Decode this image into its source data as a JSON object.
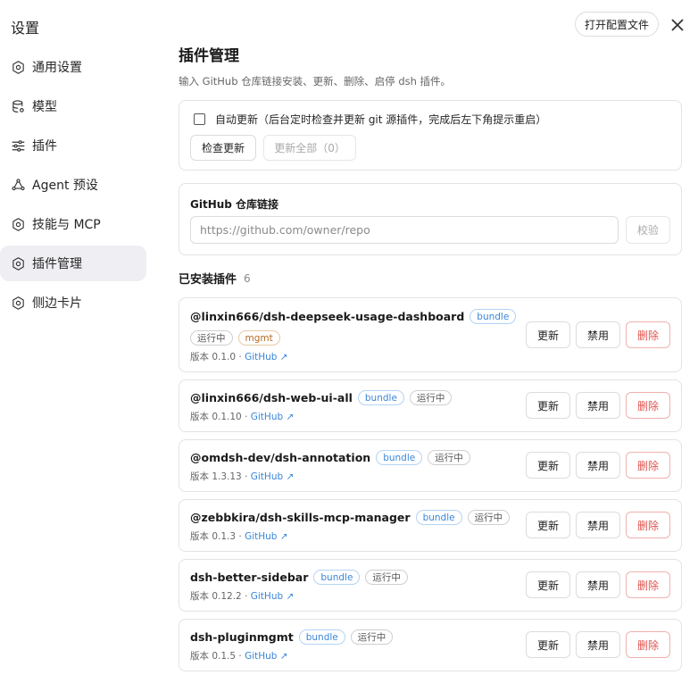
{
  "sidebar": {
    "title": "设置",
    "items": [
      {
        "label": "通用设置",
        "icon": "settings-gear-icon"
      },
      {
        "label": "模型",
        "icon": "database-icon"
      },
      {
        "label": "插件",
        "icon": "sliders-icon"
      },
      {
        "label": "Agent 预设",
        "icon": "agent-icon"
      },
      {
        "label": "技能与 MCP",
        "icon": "settings-gear-icon"
      },
      {
        "label": "插件管理",
        "icon": "settings-gear-icon",
        "active": true
      },
      {
        "label": "侧边卡片",
        "icon": "settings-gear-icon"
      }
    ]
  },
  "header": {
    "open_config_label": "打开配置文件",
    "close_icon": "close-icon"
  },
  "main": {
    "title": "插件管理",
    "description": "输入 GitHub 仓库链接安装、更新、删除、启停 dsh 插件。",
    "auto_update": {
      "checked": false,
      "label": "自动更新（后台定时检查并更新 git 源插件，完成后左下角提示重启）",
      "check_label": "检查更新",
      "update_all_label": "更新全部（0）"
    },
    "repo": {
      "label": "GitHub 仓库链接",
      "placeholder": "https://github.com/owner/repo",
      "verify_label": "校验"
    },
    "installed": {
      "title": "已安装插件",
      "count": "6"
    },
    "plugins": [
      {
        "name": "@linxin666/dsh-deepseek-usage-dashboard",
        "tags": [
          "bundle"
        ],
        "tags2": [
          "运行中",
          "mgmt"
        ],
        "version": "版本 0.1.0 · ",
        "github": "GitHub ↗"
      },
      {
        "name": "@linxin666/dsh-web-ui-all",
        "tags": [
          "bundle",
          "运行中"
        ],
        "version": "版本 0.1.10 · ",
        "github": "GitHub ↗"
      },
      {
        "name": "@omdsh-dev/dsh-annotation",
        "tags": [
          "bundle",
          "运行中"
        ],
        "version": "版本 1.3.13 · ",
        "github": "GitHub ↗"
      },
      {
        "name": "@zebbkira/dsh-skills-mcp-manager",
        "tags": [
          "bundle",
          "运行中"
        ],
        "version": "版本 0.1.3 · ",
        "github": "GitHub ↗"
      },
      {
        "name": "dsh-better-sidebar",
        "tags": [
          "bundle",
          "运行中"
        ],
        "version": "版本 0.12.2 · ",
        "github": "GitHub ↗"
      },
      {
        "name": "dsh-pluginmgmt",
        "tags": [
          "bundle",
          "运行中"
        ],
        "version": "版本 0.1.5 · ",
        "github": "GitHub ↗"
      }
    ],
    "actions": {
      "update_label": "更新",
      "disable_label": "禁用",
      "delete_label": "删除"
    }
  },
  "colors": {
    "accent": "#3a86d8",
    "danger": "#e0554f",
    "active_bg": "#efeff3"
  }
}
